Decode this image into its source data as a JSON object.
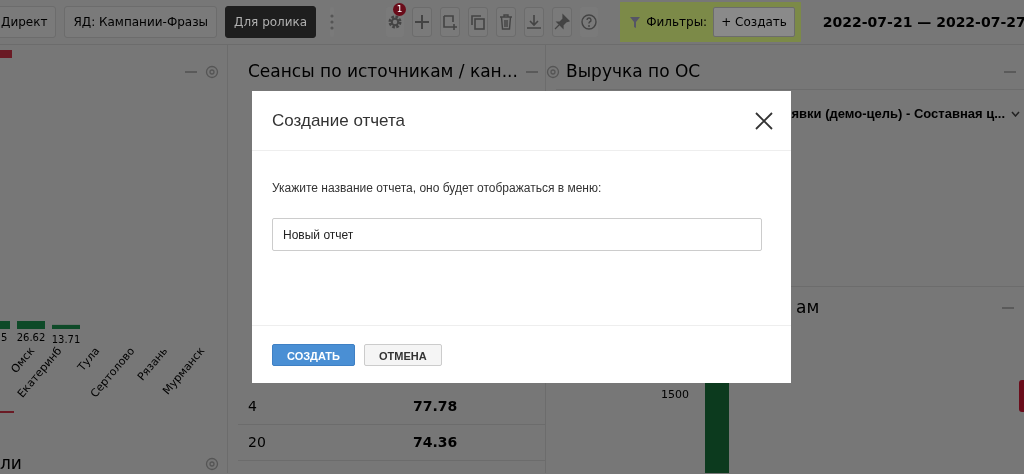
{
  "toolbar": {
    "report_tabs": [
      {
        "label": "Директ",
        "selected": false
      },
      {
        "label": "ЯД: Кампании-Фразы",
        "selected": false
      },
      {
        "label": "Для ролика",
        "selected": true
      }
    ],
    "notification_count": "1",
    "filters": {
      "label": "Фильтры:",
      "create_button": "+ Создать"
    },
    "date_range": "2022-07-21 — 2022-07-27"
  },
  "left_panel": {
    "cut_bar_label": "5",
    "chart_data": {
      "type": "bar",
      "categories": [
        "Омск",
        "Екатеринб",
        "Тула",
        "Сертолово",
        "Рязань",
        "Мурманск"
      ],
      "values": [
        26.62,
        13.71,
        null,
        null,
        null,
        null
      ],
      "data_labels": true
    },
    "bottom_title": "ли"
  },
  "middle_panel": {
    "title": "Сеансы по источникам / кан...",
    "rows": [
      {
        "column_1": "4",
        "column_2": "77.78"
      },
      {
        "column_1": "20",
        "column_2": "74.36"
      }
    ]
  },
  "right_panel": {
    "title": "Выручка по ОС",
    "dropdown_value": "явки (демо-цель) - Составная ц...",
    "section_title": "ам",
    "axis_tick": "1500"
  },
  "modal": {
    "title": "Создание отчета",
    "prompt": "Укажите название отчета, оно будет отображаться в меню:",
    "input_value": "Новый отчет",
    "buttons": [
      {
        "label": "СОЗДАТЬ",
        "kind": "primary"
      },
      {
        "label": "ОТМЕНА",
        "kind": "secondary"
      }
    ]
  }
}
